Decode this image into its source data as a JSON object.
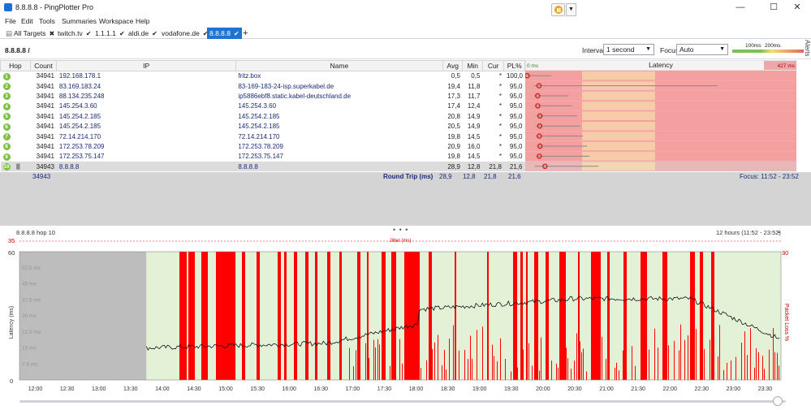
{
  "window": {
    "title": "8.8.8.8 - PingPlotter Pro",
    "controls": {
      "minimize": "—",
      "maximize": "☐",
      "close": "✕"
    }
  },
  "menu": [
    "File",
    "Edit",
    "Tools",
    "Summaries",
    "Workspace",
    "Help"
  ],
  "tabs": [
    {
      "label": "All Targets",
      "mark": "✖",
      "active": false
    },
    {
      "label": "twitch.tv",
      "mark": "✔",
      "active": false
    },
    {
      "label": "1.1.1.1",
      "mark": "✔",
      "active": false
    },
    {
      "label": "aldi.de",
      "mark": "✔",
      "active": false
    },
    {
      "label": "vodafone.de",
      "mark": "✔",
      "active": false
    },
    {
      "label": "8.8.8.8",
      "mark": "✔",
      "active": true
    }
  ],
  "add_tab": "+",
  "toolbar": {
    "target": "8.8.8.8 /",
    "interval_label": "Interval",
    "interval_value": "1 second",
    "focus_label": "Focus",
    "focus_value": "Auto",
    "scale_100": "100ms",
    "scale_200": "200ms",
    "alerts": "Alerts"
  },
  "table": {
    "headers": {
      "hop": "Hop",
      "count": "Count",
      "ip": "IP",
      "name": "Name",
      "avg": "Avg",
      "min": "Min",
      "cur": "Cur",
      "pl": "PL%",
      "latency": "Latency",
      "lat_min": "0 ms",
      "lat_max": "427 ms"
    },
    "rows": [
      {
        "hop": "1",
        "count": "34941",
        "ip": "192.168.178.1",
        "name": "fritz.box",
        "avg": "0,5",
        "min": "0,5",
        "cur": "*",
        "pl": "100,0"
      },
      {
        "hop": "2",
        "count": "34941",
        "ip": "83.169.183.24",
        "name": "83-169-183-24-isp.superkabel.de",
        "avg": "19,4",
        "min": "11,8",
        "cur": "*",
        "pl": "95,0"
      },
      {
        "hop": "3",
        "count": "34941",
        "ip": "88.134.235.248",
        "name": "ip5886ebf8.static.kabel-deutschland.de",
        "avg": "17,3",
        "min": "11,7",
        "cur": "*",
        "pl": "95,0"
      },
      {
        "hop": "4",
        "count": "34941",
        "ip": "145.254.3.60",
        "name": "145.254.3.60",
        "avg": "17,4",
        "min": "12,4",
        "cur": "*",
        "pl": "95,0"
      },
      {
        "hop": "5",
        "count": "34941",
        "ip": "145.254.2.185",
        "name": "145.254.2.185",
        "avg": "20,8",
        "min": "14,9",
        "cur": "*",
        "pl": "95,0"
      },
      {
        "hop": "6",
        "count": "34941",
        "ip": "145.254.2.185",
        "name": "145.254.2.185",
        "avg": "20,5",
        "min": "14,9",
        "cur": "*",
        "pl": "95,0"
      },
      {
        "hop": "7",
        "count": "34941",
        "ip": "72.14.214.170",
        "name": "72.14.214.170",
        "avg": "19,8",
        "min": "14,5",
        "cur": "*",
        "pl": "95,0"
      },
      {
        "hop": "8",
        "count": "34941",
        "ip": "172.253.78.209",
        "name": "172.253.78.209",
        "avg": "20,9",
        "min": "16,0",
        "cur": "*",
        "pl": "95,0"
      },
      {
        "hop": "9",
        "count": "34941",
        "ip": "172.253.75.147",
        "name": "172.253.75.147",
        "avg": "19,8",
        "min": "14,5",
        "cur": "*",
        "pl": "95,0"
      },
      {
        "hop": "10",
        "count": "34943",
        "ip": "8.8.8.8",
        "name": "8.8.8.8",
        "avg": "28,9",
        "min": "12,8",
        "cur": "21,8",
        "pl": "21,6"
      }
    ],
    "summary": {
      "count": "34943",
      "label": "Round Trip (ms)",
      "avg": "28,9",
      "min": "12,8",
      "cur": "21,8",
      "pl": "21,6",
      "focus": "Focus: 11:52 - 23:52"
    }
  },
  "splitter": "• • •",
  "timeline": {
    "title": "8.8.8.8 hop 10",
    "range": "12 hours (11:52 - 23:52)",
    "jitter_max": "35",
    "jitter_label": "Jitter (ms)",
    "y_max": "60",
    "y_min": "0",
    "y_ticks": [
      "52,5 ms",
      "45 ms",
      "37,5 ms",
      "30 ms",
      "22,5 ms",
      "15 ms",
      "7,5 ms"
    ],
    "ylabel": "Latency (ms)",
    "loss_label": "Packet Loss %",
    "loss_max": "30",
    "x_labels": [
      "12:00",
      "12:30",
      "13:00",
      "13:30",
      "14:00",
      "14:30",
      "15:00",
      "15:30",
      "16:00",
      "16:30",
      "17:00",
      "17:30",
      "18:00",
      "18:30",
      "19:00",
      "19:30",
      "20:00",
      "20:30",
      "21:00",
      "21:30",
      "22:00",
      "22:30",
      "23:00",
      "23:30"
    ]
  },
  "colors": {
    "accent": "#1e74d0",
    "good_bg": "#e3f1d6",
    "loss": "#ff0000",
    "lat_bad": "#f5a0a0",
    "lat_warn": "#f8f0b0",
    "hop_badge": "#7bc043"
  }
}
